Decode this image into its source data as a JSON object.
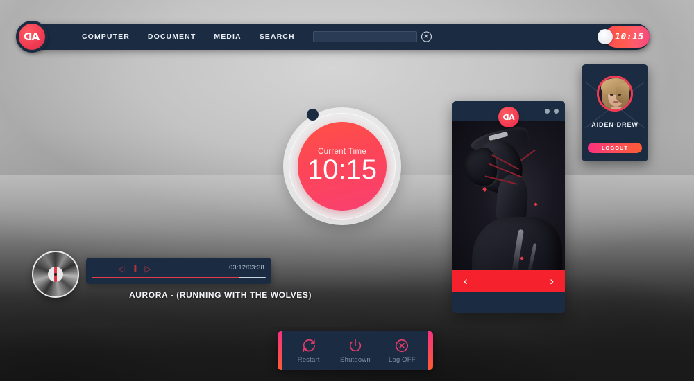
{
  "navbar": {
    "logo_mark": "AD",
    "logo_icon": "ad-logo-icon",
    "items": [
      {
        "label": "COMPUTER"
      },
      {
        "label": "DOCUMENT"
      },
      {
        "label": "MEDIA"
      },
      {
        "label": "SEARCH"
      }
    ],
    "search": {
      "value": "",
      "placeholder": "",
      "clear_icon": "close-circle-icon"
    },
    "toggle": {
      "time": "10:15",
      "knob_icon": "toggle-knob-icon"
    }
  },
  "clock_widget": {
    "label": "Current Time",
    "time": "10:15",
    "accent": "#fa3f71",
    "dot_color": "#1b2c42"
  },
  "media_panel": {
    "badge_mark": "AD",
    "badge_icon": "ad-logo-icon",
    "window_dots": [
      "minimize-dot",
      "close-dot"
    ],
    "artwork_alt": "cyber-figure-artwork",
    "prev_arrow": "‹",
    "next_arrow": "›",
    "footer_color": "#f5222d"
  },
  "profile": {
    "name": "AIDEN-DREW",
    "avatar_icon": "user-avatar",
    "logout_label": "LOGOUT",
    "logout_gradient_from": "#f9307f",
    "logout_gradient_to": "#fc5c34",
    "ring_color": "#f03b55"
  },
  "player": {
    "disc_icon": "vinyl-disc-icon",
    "prev_icon": "◁",
    "pause_icon": "II",
    "next_icon": "▷",
    "time": "03:12/03:38",
    "progress_percent": 85,
    "track_title": "AURORA - (RUNNING WITH THE WOLVES)",
    "accent": "#e23b4a"
  },
  "power_menu": {
    "items": [
      {
        "label": "Restart",
        "icon": "restart-icon"
      },
      {
        "label": "Shutdown",
        "icon": "power-icon"
      },
      {
        "label": "Log OFF",
        "icon": "logoff-icon"
      }
    ],
    "accent_from": "#f9307f",
    "accent_to": "#fc5c34"
  }
}
